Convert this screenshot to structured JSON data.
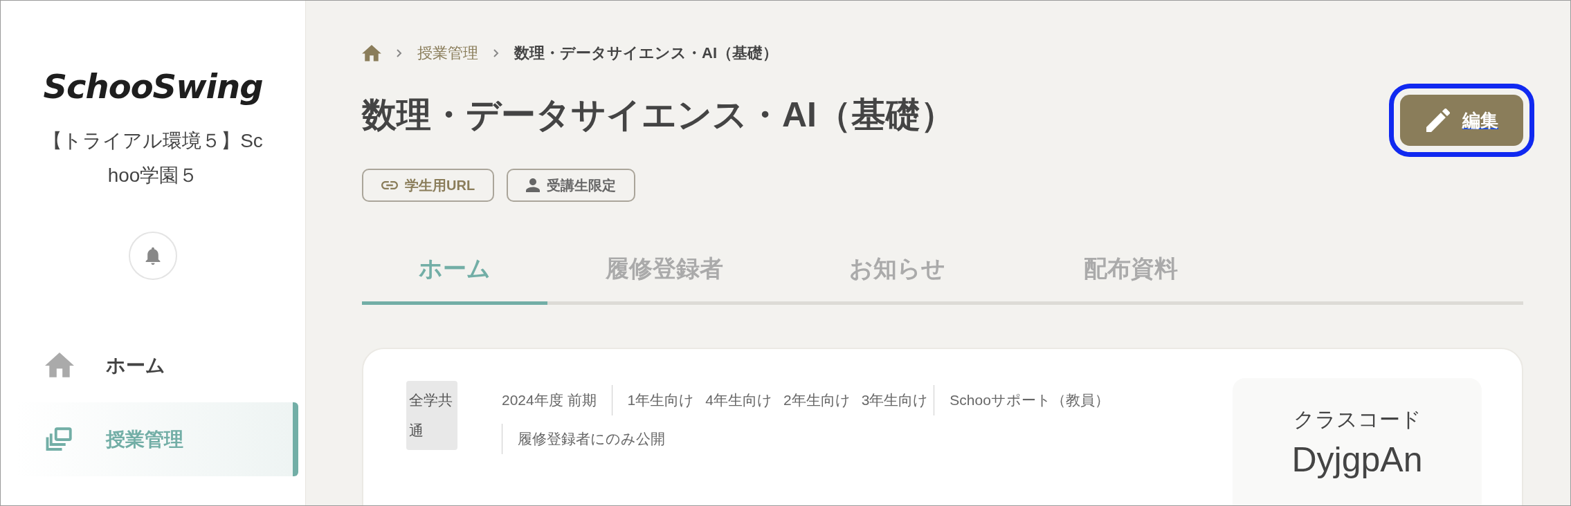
{
  "sidebar": {
    "logo": "SchooSwing",
    "organization": "【トライアル環境５】Schoo学園５",
    "nav": [
      {
        "label": "ホーム",
        "kind": "home",
        "selected": false
      },
      {
        "label": "授業管理",
        "kind": "classes",
        "selected": true
      }
    ]
  },
  "breadcrumb": [
    "授業管理",
    "数理・データサイエンス・AI（基礎）"
  ],
  "title": "数理・データサイエンス・AI（基礎）",
  "edit_button": {
    "label": "編集",
    "focused": true
  },
  "chips": [
    {
      "label": "学生用URL",
      "kind": "link"
    },
    {
      "label": "受講生限定",
      "kind": "restriction"
    }
  ],
  "tabs": [
    {
      "label": "ホーム",
      "selected": true
    },
    {
      "label": "履修登録者",
      "selected": false
    },
    {
      "label": "お知らせ",
      "selected": false
    },
    {
      "label": "配布資料",
      "selected": false
    }
  ],
  "course": {
    "category": "全学共通",
    "term": "2024年度 前期",
    "grades": [
      "1年生向け",
      "4年生向け",
      "2年生向け",
      "3年生向け"
    ],
    "instructor": "Schooサポート（教員）",
    "visibility": "履修登録者にのみ公開"
  },
  "class_code": {
    "label": "クラスコード",
    "value": "DyjgpAn"
  }
}
